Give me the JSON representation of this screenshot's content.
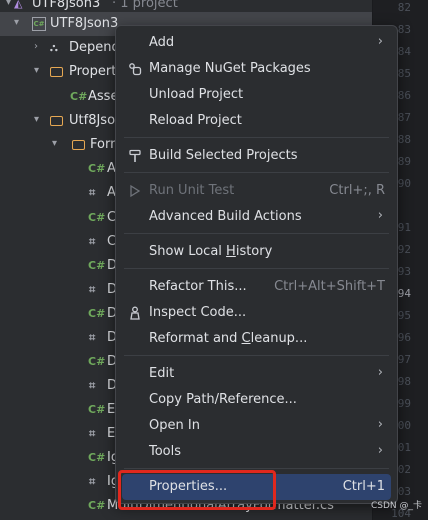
{
  "tree": {
    "rows": [
      {
        "label": "UTF8Json3",
        "suffix": "· 1 project"
      },
      {
        "label": "UTF8Json3"
      },
      {
        "label": "Depend"
      },
      {
        "label": "Propert"
      },
      {
        "label": "Asse"
      },
      {
        "label": "Utf8Jso"
      },
      {
        "label": "Form"
      },
      {
        "label": "A"
      },
      {
        "label": "A"
      },
      {
        "label": "C"
      },
      {
        "label": "C"
      },
      {
        "label": "D"
      },
      {
        "label": "D"
      },
      {
        "label": "D"
      },
      {
        "label": "D"
      },
      {
        "label": "D"
      },
      {
        "label": "D"
      },
      {
        "label": "E"
      },
      {
        "label": "E"
      },
      {
        "label": "Ig"
      },
      {
        "label": "Ig"
      },
      {
        "label": "MultiDimentionalArrayFormatter.cs"
      }
    ],
    "cs_badge": "C#"
  },
  "gutter": {
    "lines": [
      "82",
      "83",
      "84",
      "85",
      "86",
      "87",
      "88",
      "89",
      "90",
      "91",
      "92",
      "93",
      "94",
      "95",
      "96",
      "97",
      "98",
      "99",
      "100",
      "101",
      "102",
      "103",
      "104"
    ],
    "current": "94"
  },
  "menu": {
    "add": "Add",
    "manage_nuget": "Manage NuGet Packages",
    "unload": "Unload Project",
    "reload": "Reload Project",
    "build_selected": "Build Selected Projects",
    "run_unit_test": "Run Unit Test",
    "run_unit_test_shortcut": "Ctrl+;, R",
    "advanced_build": "Advanced Build Actions",
    "show_history_pre": "Show Local ",
    "show_history_u": "H",
    "show_history_post": "istory",
    "refactor_this": "Refactor This...",
    "refactor_shortcut": "Ctrl+Alt+Shift+T",
    "inspect_code": "Inspect Code...",
    "reformat_pre": "Reformat and ",
    "reformat_u": "C",
    "reformat_post": "leanup...",
    "edit": "Edit",
    "copy_path": "Copy Path/Reference...",
    "open_in": "Open In",
    "tools": "Tools",
    "properties": "Properties...",
    "properties_shortcut": "Ctrl+1",
    "arrow": "›"
  },
  "watermark": "CSDN @_卡",
  "colors": {
    "accent_selection": "#2e436e",
    "highlight_box": "#e0281e",
    "cs_badge": "#6fa85c",
    "folder": "#e6a853"
  }
}
